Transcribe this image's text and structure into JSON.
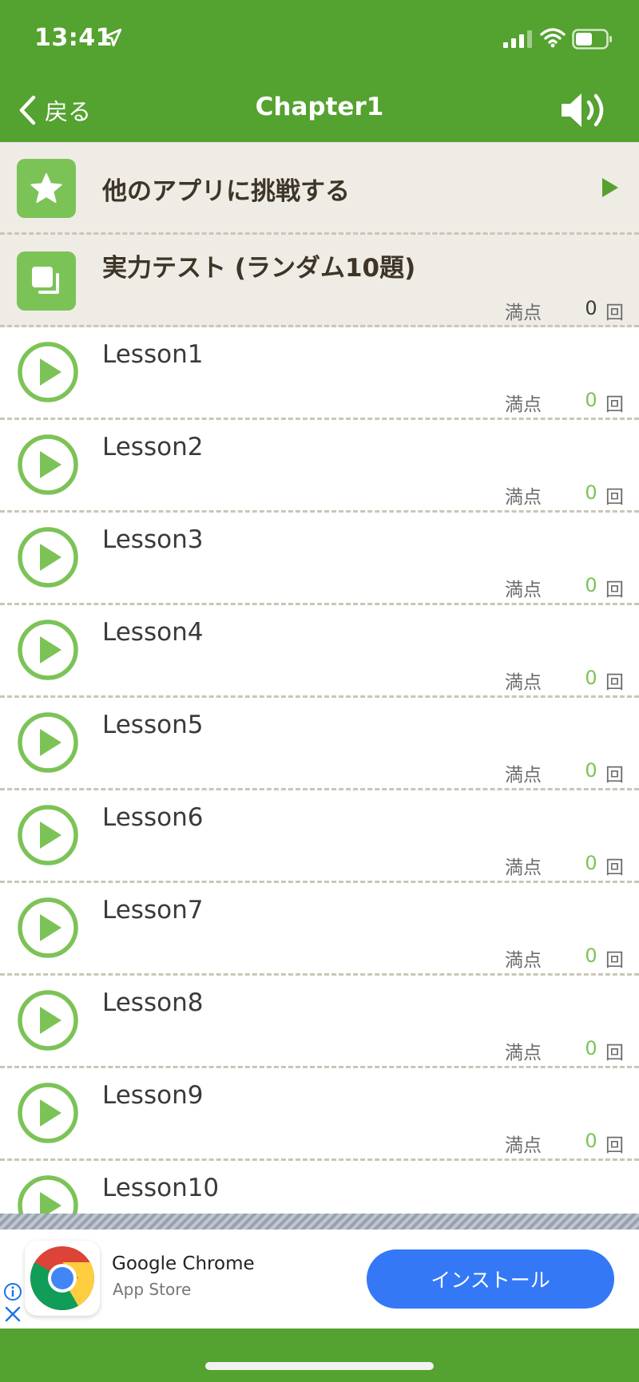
{
  "status_bar": {
    "time": "13:41"
  },
  "nav": {
    "back_label": "戻る",
    "title": "Chapter1"
  },
  "special_rows": {
    "other_apps": {
      "title": "他のアプリに挑戦する"
    },
    "practice_test": {
      "title": "実力テスト (ランダム10題)",
      "score_label": "満点",
      "score_value": "0",
      "score_unit": "回"
    }
  },
  "lessons": [
    {
      "title": "Lesson1",
      "score_label": "満点",
      "score_value": "0",
      "score_unit": "回"
    },
    {
      "title": "Lesson2",
      "score_label": "満点",
      "score_value": "0",
      "score_unit": "回"
    },
    {
      "title": "Lesson3",
      "score_label": "満点",
      "score_value": "0",
      "score_unit": "回"
    },
    {
      "title": "Lesson4",
      "score_label": "満点",
      "score_value": "0",
      "score_unit": "回"
    },
    {
      "title": "Lesson5",
      "score_label": "満点",
      "score_value": "0",
      "score_unit": "回"
    },
    {
      "title": "Lesson6",
      "score_label": "満点",
      "score_value": "0",
      "score_unit": "回"
    },
    {
      "title": "Lesson7",
      "score_label": "満点",
      "score_value": "0",
      "score_unit": "回"
    },
    {
      "title": "Lesson8",
      "score_label": "満点",
      "score_value": "0",
      "score_unit": "回"
    },
    {
      "title": "Lesson9",
      "score_label": "満点",
      "score_value": "0",
      "score_unit": "回"
    },
    {
      "title": "Lesson10"
    }
  ],
  "ad": {
    "app_name": "Google Chrome",
    "store": "App Store",
    "install_label": "インストール"
  },
  "colors": {
    "header_green": "#54a22f",
    "accent_green": "#7cc357",
    "row_bg": "#efece6",
    "install_blue": "#3478f6"
  }
}
